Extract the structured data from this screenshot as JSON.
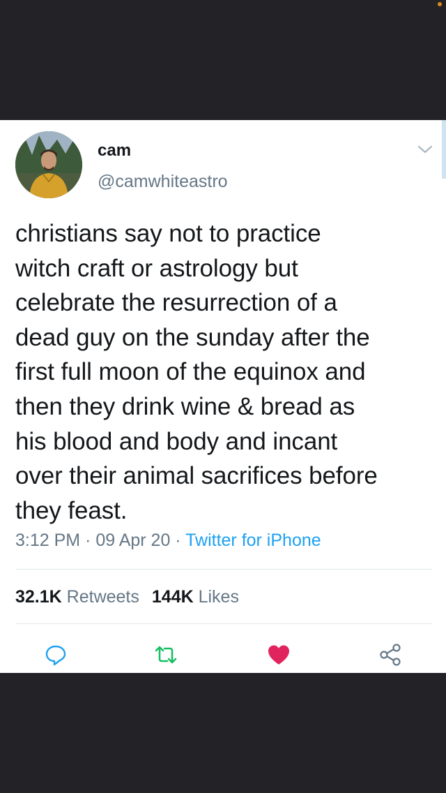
{
  "tweet": {
    "display_name": "cam",
    "handle": "@camwhiteastro",
    "text": "christians say not to practice\nwitch craft or astrology but\ncelebrate the resurrection of a\ndead guy on the sunday after the\nfirst full moon of the equinox and\nthen they drink wine & bread as\nhis blood and body and incant\nover their animal sacrifices before\nthey feast.",
    "time": "3:12 PM",
    "separator": " · ",
    "date": "09 Apr 20",
    "source": "Twitter for iPhone"
  },
  "stats": {
    "retweets_count": "32.1K",
    "retweets_label": " Retweets",
    "likes_count": "144K",
    "likes_label": " Likes"
  },
  "actions": {
    "reply_icon": "reply-icon",
    "retweet_icon": "retweet-icon",
    "like_icon": "heart-icon",
    "share_icon": "share-icon"
  },
  "colors": {
    "background_dark": "#232327",
    "card": "#ffffff",
    "text": "#14171a",
    "secondary": "#657786",
    "link": "#1da1f2",
    "retweet_green": "#17bf63",
    "like_red": "#e0245e"
  }
}
